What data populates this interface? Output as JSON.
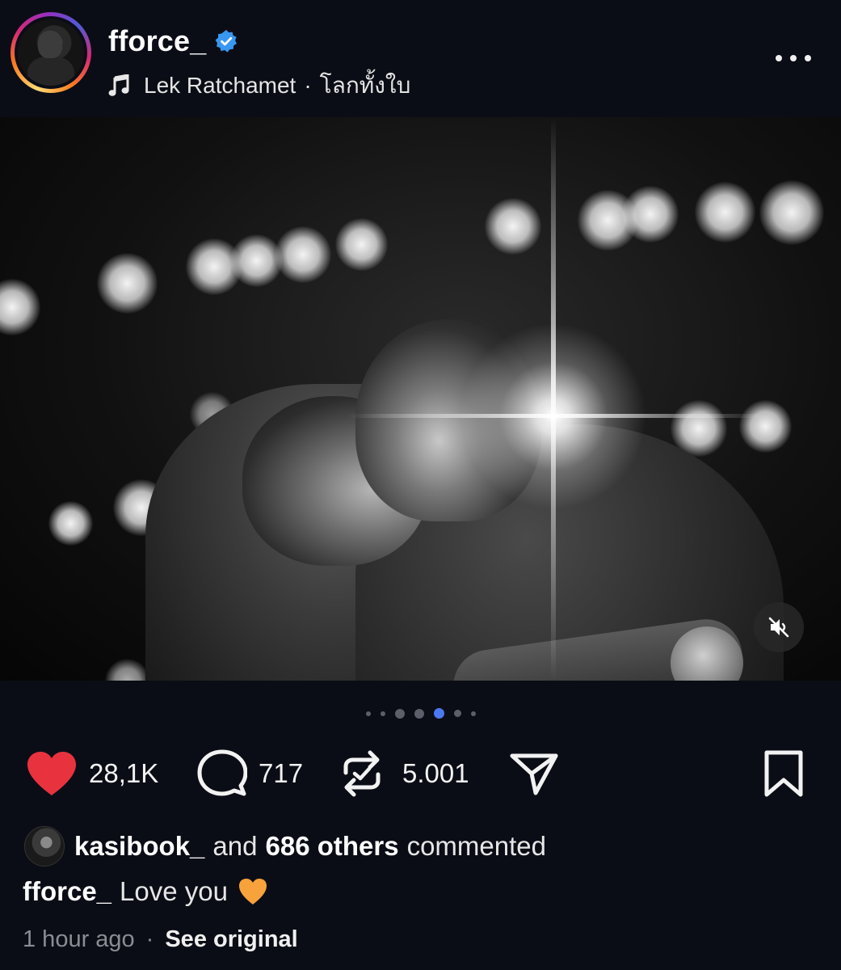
{
  "post": {
    "username": "fforce_",
    "verified": true,
    "music": {
      "artist": "Lek Ratchamet",
      "separator": "·",
      "track": "โลกทั้งใบ"
    }
  },
  "media": {
    "carousel_total": 7,
    "carousel_active_index": 4,
    "muted": true
  },
  "actions": {
    "likes": "28,1K",
    "comments": "717",
    "reposts": "5.001"
  },
  "comments_summary": {
    "user": "kasibook_",
    "and": "and",
    "others": "686 others",
    "commented": "commented"
  },
  "caption": {
    "username": "fforce_",
    "text": "Love you",
    "emoji": "orange-heart"
  },
  "meta": {
    "time": "1 hour ago",
    "separator": "·",
    "see_original": "See original"
  },
  "colors": {
    "background": "#0b0d16",
    "like_red": "#e8333f",
    "verified_blue": "#3897f0",
    "active_dot": "#4a78f0",
    "orange_heart": "#f7a23b"
  }
}
